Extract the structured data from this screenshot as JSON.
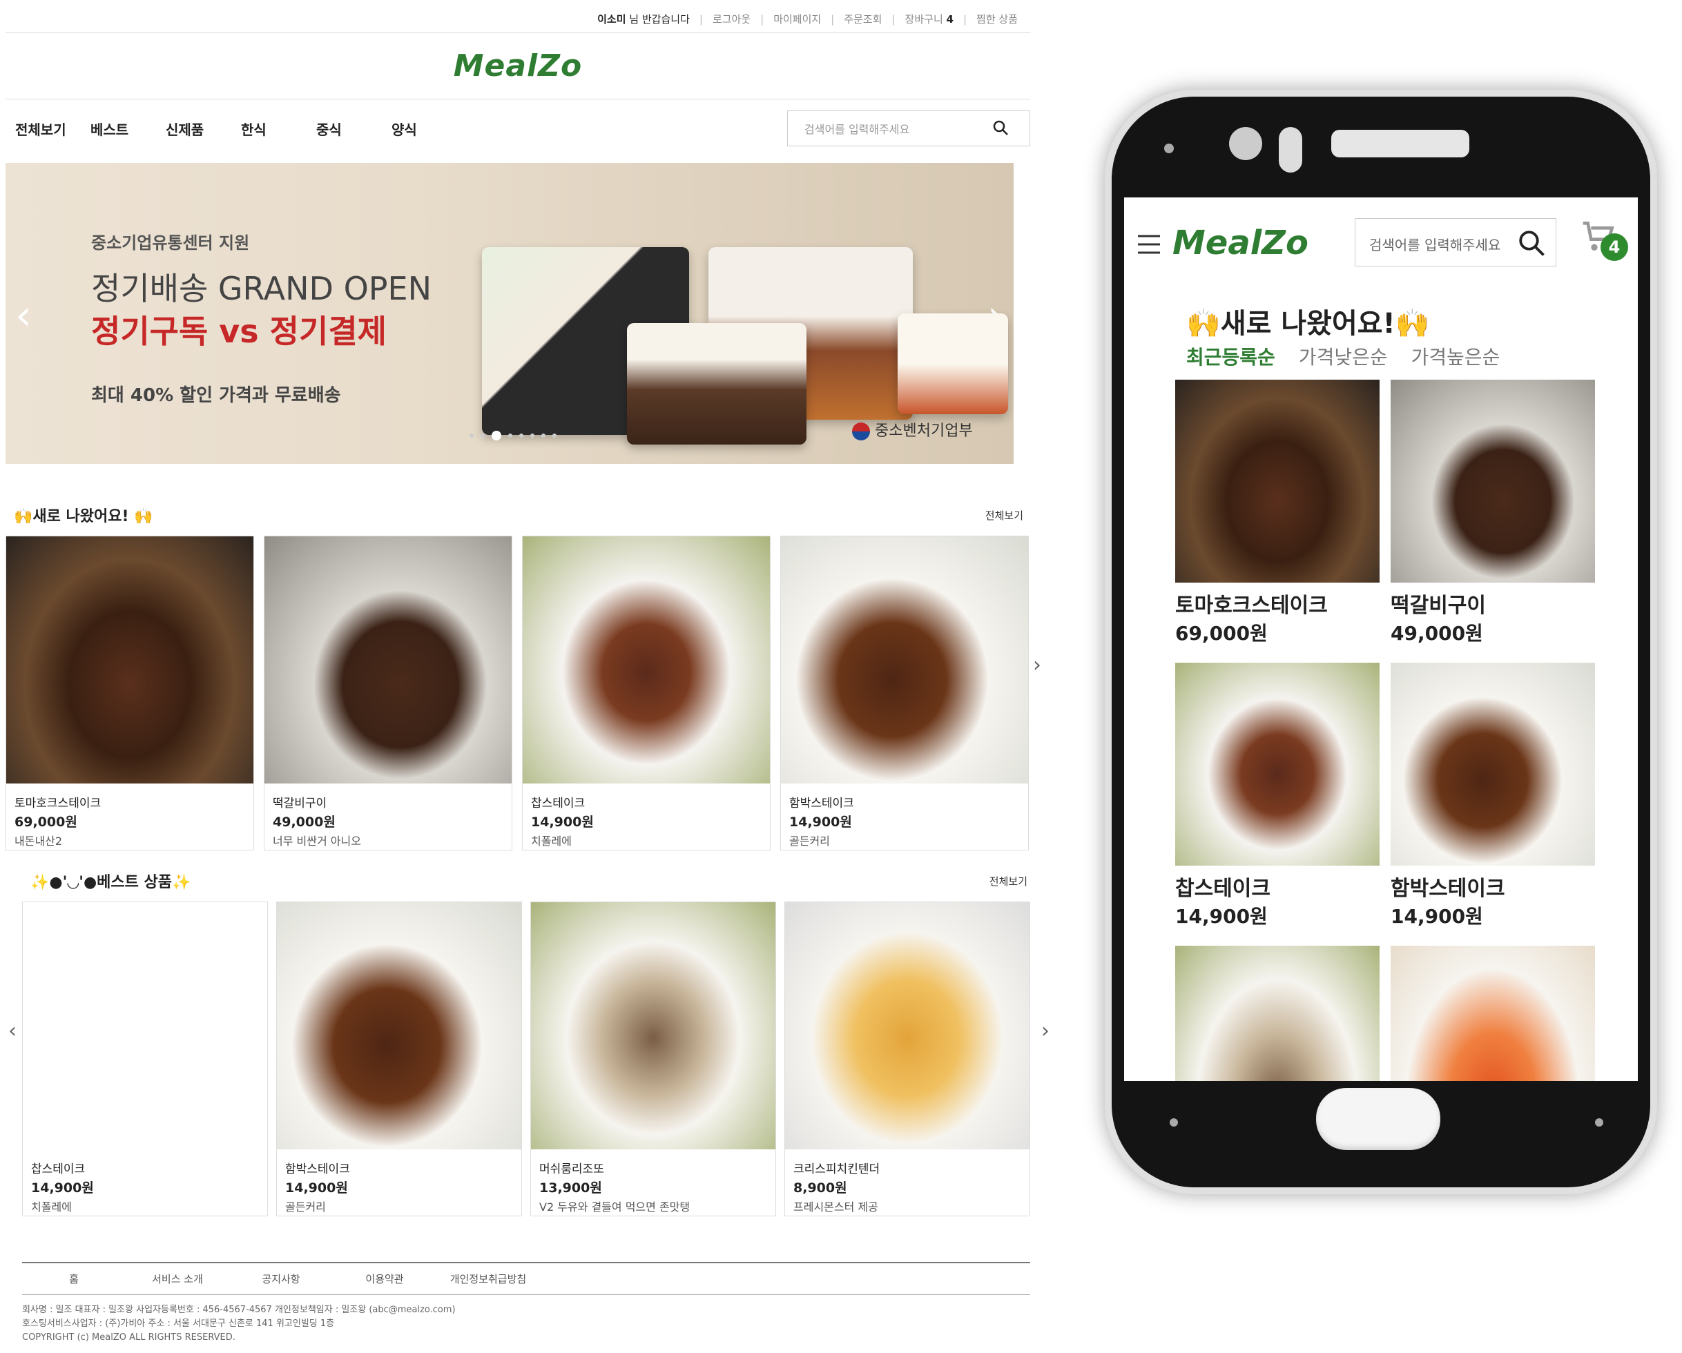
{
  "desktop": {
    "topbar": {
      "greeting_name": "이소미",
      "greeting_rest": "님 반갑습니다",
      "logout": "로그아웃",
      "mypage": "마이페이지",
      "order": "주문조회",
      "cart": "장바구니",
      "cart_count": "4",
      "wishlist": "찜한 상품"
    },
    "logo": "MealZo",
    "nav": [
      "전체보기",
      "베스트",
      "신제품",
      "한식",
      "중식",
      "양식"
    ],
    "search_placeholder": "검색어를 입력해주세요",
    "banner": {
      "subtitle": "중소기업유통센터 지원",
      "title": "정기배송 GRAND OPEN",
      "headline": "정기구독 vs 정기결제",
      "discount": "최대 40% 할인 가격과 무료배송",
      "sponsor": "중소벤처기업부",
      "slide_count": 8,
      "active_slide": 2
    },
    "new_section": {
      "title": "🙌새로 나왔어요! 🙌",
      "more": "전체보기",
      "items": [
        {
          "name": "토마호크스테이크",
          "price": "69,000원",
          "desc": "내돈내산2"
        },
        {
          "name": "떡갈비구이",
          "price": "49,000원",
          "desc": "너무 비싼거 아니오"
        },
        {
          "name": "찹스테이크",
          "price": "14,900원",
          "desc": "치폴레에"
        },
        {
          "name": "함박스테이크",
          "price": "14,900원",
          "desc": "골든커리"
        }
      ]
    },
    "best_section": {
      "title": "✨●'◡'●베스트 상품✨",
      "more": "전체보기",
      "items": [
        {
          "name": "찹스테이크",
          "price": "14,900원",
          "desc": "치폴레에"
        },
        {
          "name": "함박스테이크",
          "price": "14,900원",
          "desc": "골든커리"
        },
        {
          "name": "머쉬룸리조또",
          "price": "13,900원",
          "desc": "V2 두유와 곁들여 먹으면 존맛탱"
        },
        {
          "name": "크리스피치킨텐더",
          "price": "8,900원",
          "desc": "프레시몬스터 제공"
        }
      ]
    },
    "footer": {
      "nav": [
        "홈",
        "서비스 소개",
        "공지사항",
        "이용약관",
        "개인정보취급방침"
      ],
      "info_line1": "회사명 : 밀조    대표자 :  밀조왕    사업자등록번호 : 456-4567-4567    개인정보책임자 : 밀조왕 (abc@mealzo.com)",
      "info_line2": "호스팅서비스사업자 : (주)가비아    주소 : 서울 서대문구 신촌로 141 위고인빌딩 1층",
      "copyright": "COPYRIGHT (c) MealZO ALL RIGHTS RESERVED."
    }
  },
  "mobile": {
    "logo": "MealZo",
    "search_placeholder": "검색어를 입력해주세요",
    "cart_count": "4",
    "section_title": "새로 나왔어요!",
    "sort": [
      "최근등록순",
      "가격낮은순",
      "가격높은순"
    ],
    "items": [
      {
        "name": "토마호크스테이크",
        "price": "69,000원"
      },
      {
        "name": "떡갈비구이",
        "price": "49,000원"
      },
      {
        "name": "찹스테이크",
        "price": "14,900원"
      },
      {
        "name": "함박스테이크",
        "price": "14,900원"
      }
    ]
  },
  "colors": {
    "brand_green": "#2e7d32",
    "banner_red": "#c62828",
    "cart_badge": "#2e8b2e"
  }
}
